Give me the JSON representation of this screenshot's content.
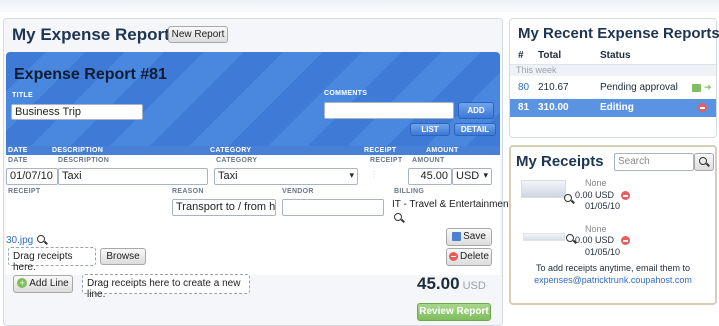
{
  "header": {
    "title": "My Expense Reports",
    "new_report": "New Report"
  },
  "report": {
    "title": "Expense Report #81",
    "title_label": "TITLE",
    "title_value": "Business Trip",
    "comments_label": "COMMENTS",
    "add": "ADD",
    "list": "LIST",
    "detail": "DETAIL"
  },
  "columns": {
    "date": "DATE",
    "description": "DESCRIPTION",
    "category": "CATEGORY",
    "receipt": "RECEIPT",
    "amount": "AMOUNT"
  },
  "line": {
    "date_label": "DATE",
    "description_label": "DESCRIPTION",
    "category_label": "CATEGORY",
    "receipt_label": "RECEIPT",
    "amount_label": "AMOUNT",
    "date": "01/07/10",
    "description": "Taxi",
    "category": "Taxi",
    "amount": "45.00",
    "currency": "USD",
    "receipt_lbl": "RECEIPT",
    "reason_label": "REASON",
    "vendor_label": "VENDOR",
    "billing_label": "BILLING",
    "reason": "Transport to / from h",
    "billing": "IT - Travel & Entertainment",
    "file": "30.jpg",
    "drag": "Drag receipts here.",
    "browse": "Browse",
    "save": "Save",
    "delete": "Delete"
  },
  "footer": {
    "add_line": "Add Line",
    "drag_line": "Drag receipts here to create a new line.",
    "total": "45.00",
    "total_currency": "USD",
    "review": "Review Report"
  },
  "recent": {
    "title": "My Recent Expense Reports",
    "headers": {
      "num": "#",
      "total": "Total",
      "status": "Status"
    },
    "group": "This week",
    "rows": [
      {
        "num": "80",
        "total": "210.67",
        "status": "Pending approval"
      },
      {
        "num": "81",
        "total": "310.00",
        "status": "Editing"
      }
    ]
  },
  "receipts": {
    "title": "My Receipts",
    "search_placeholder": "Search",
    "items": [
      {
        "name": "None",
        "amount": "0.00 USD",
        "date": "01/05/10"
      },
      {
        "name": "None",
        "amount": "0.00 USD",
        "date": "01/05/10"
      }
    ],
    "email_note": "To add receipts anytime, email them to",
    "email": "expenses@patricktrunk.coupahost.com"
  },
  "colors": {
    "accent": "#4a88e0",
    "green": "#7fbe5d",
    "red": "#e85d5d"
  }
}
